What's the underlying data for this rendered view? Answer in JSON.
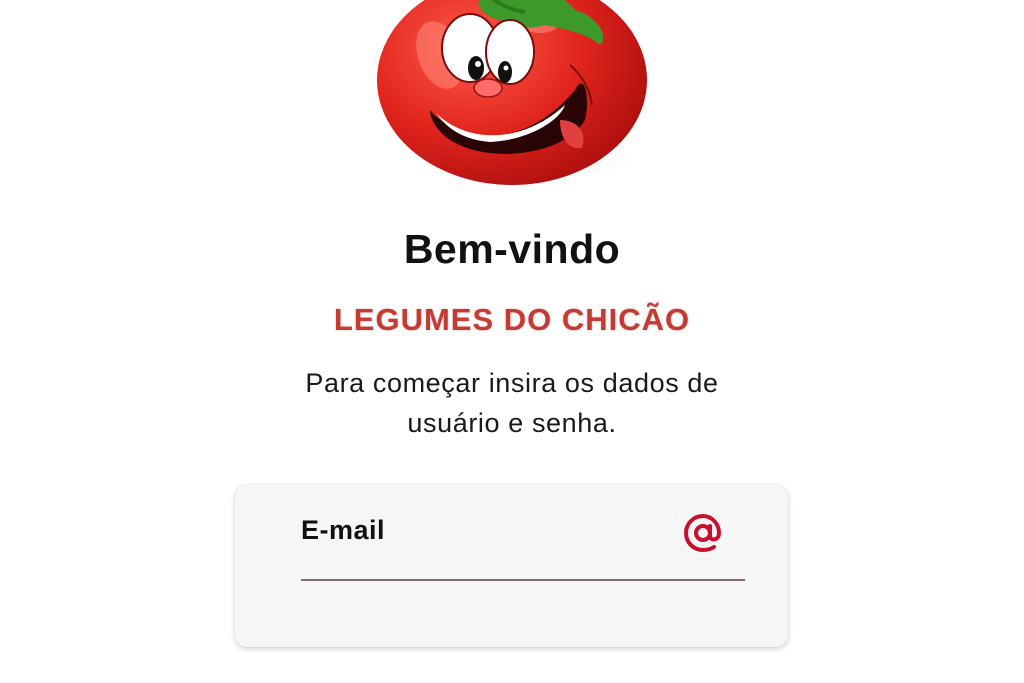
{
  "header": {
    "welcome_title": "Bem-vindo",
    "brand_name": "LEGUMES DO CHICÃO",
    "instructions": "Para começar insira os dados de usuário e senha."
  },
  "mascot": {
    "icon": "tomato-mascot-icon"
  },
  "login_form": {
    "email_label": "E-mail",
    "email_value": "",
    "email_icon": "at-icon"
  },
  "colors": {
    "accent": "#c8102e",
    "brand_text": "#c43b33",
    "card_background": "#f6f6f6"
  }
}
